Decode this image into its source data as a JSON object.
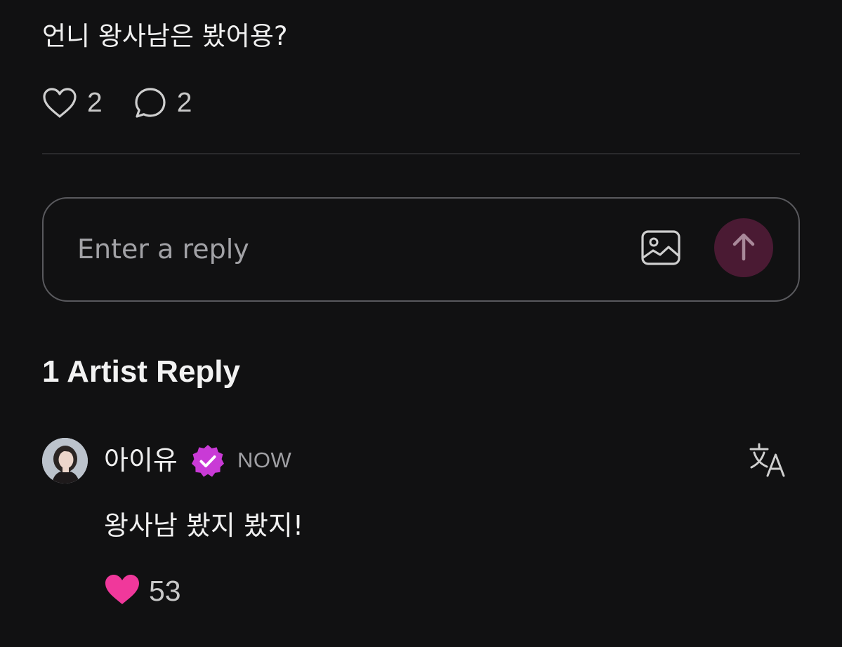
{
  "post": {
    "text": "언니 왕사남은 봤어용?",
    "like_count": "2",
    "comment_count": "2",
    "icons": {
      "like": "heart-outline-icon",
      "comment": "speech-bubble-icon"
    }
  },
  "reply_box": {
    "placeholder": "Enter a reply",
    "icons": {
      "image": "image-icon",
      "send": "arrow-up-icon"
    },
    "send_button_color": "#4a1a33"
  },
  "artist_replies": {
    "title": "1 Artist Reply",
    "items": [
      {
        "name": "아이유",
        "verified": true,
        "time": "NOW",
        "text": "왕사남 봤지 봤지!",
        "like_count": "53",
        "liked": true,
        "icons": {
          "verified": "verified-badge-icon",
          "translate": "translate-icon",
          "like": "heart-filled-icon"
        }
      }
    ]
  },
  "colors": {
    "background": "#111112",
    "accent_pink": "#f0389b",
    "verified_badge": "#c93ad6"
  }
}
